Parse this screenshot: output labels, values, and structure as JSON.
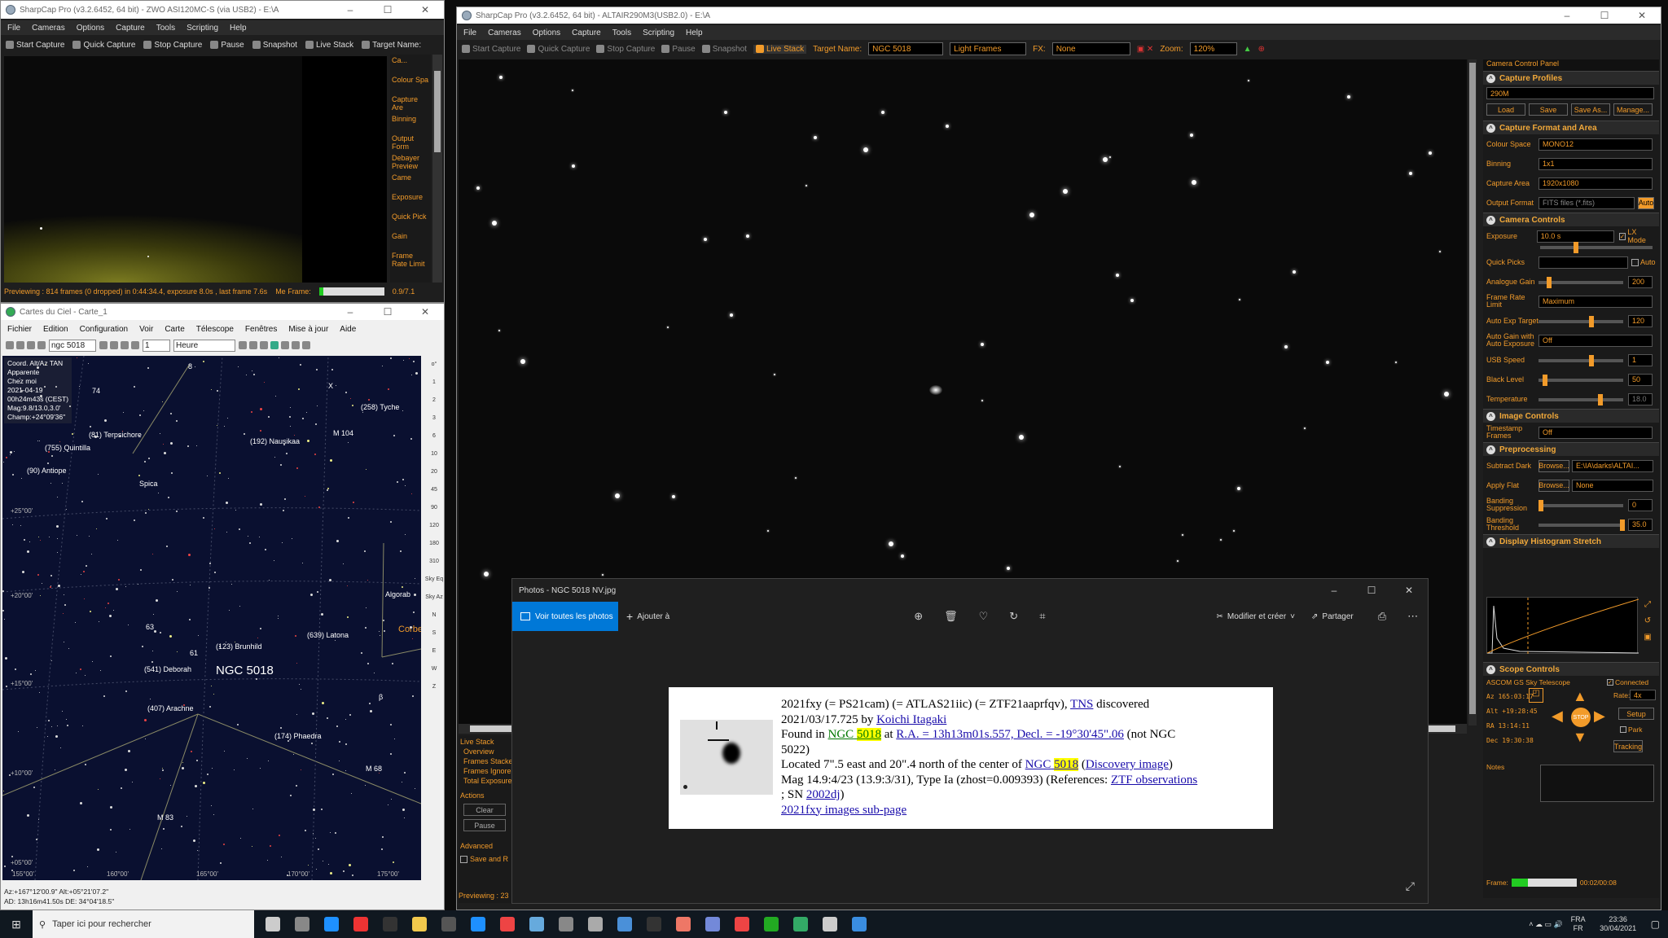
{
  "sharpcap_small": {
    "title": "SharpCap Pro (v3.2.6452, 64 bit) - ZWO ASI120MC-S (via USB2) - E:\\A",
    "menu": [
      "File",
      "Cameras",
      "Options",
      "Capture",
      "Tools",
      "Scripting",
      "Help"
    ],
    "toolbar": [
      "Start Capture",
      "Quick Capture",
      "Stop Capture",
      "Pause",
      "Snapshot",
      "Live Stack",
      "Target Name:"
    ],
    "side_labels": [
      "Ca...",
      "Colour Spa",
      "Capture Are",
      "Binning",
      "Output Form",
      "Debayer Preview",
      "Came",
      "Exposure",
      "Quick Pick",
      "Gain",
      "Frame Rate Limit"
    ],
    "status": "Previewing : 814 frames (0 dropped) in 0:44:34.4, exposure 8.0s , last frame 7.6s",
    "status_right": "Me Frame:",
    "frame_count": "0.9/7.1"
  },
  "carte": {
    "title": "Cartes du Ciel - Carte_1",
    "menu": [
      "Fichier",
      "Edition",
      "Configuration",
      "Voir",
      "Carte",
      "Télescope",
      "Fenêtres",
      "Mise à jour",
      "Aide"
    ],
    "search_value": "ngc 5018",
    "step_value": "1",
    "time_unit": "Heure",
    "info": [
      "Coord. Alt/Az TAN",
      "Apparente",
      "Chez moi",
      "2021-04-19",
      "00h24m43s (CEST)",
      "Mag:9.8/13.0,3.0'",
      "Champ:+24°09'36\""
    ],
    "labels": [
      {
        "t": "(755) Quintilla"
      },
      {
        "t": "(90) Antiope"
      },
      {
        "t": "(81) Terpsichore"
      },
      {
        "t": "(192) Nausikaa"
      },
      {
        "t": "M 104"
      },
      {
        "t": "(258) Tyche"
      },
      {
        "t": "Spica"
      },
      {
        "t": "Algorab"
      },
      {
        "t": "Corbe"
      },
      {
        "t": "(123) Brunhild"
      },
      {
        "t": "(639) Latona"
      },
      {
        "t": "(541) Deborah"
      },
      {
        "t": "NGC 5018"
      },
      {
        "t": "(407) Arachne"
      },
      {
        "t": "(174) Phaedra"
      },
      {
        "t": "M 68"
      },
      {
        "t": "M 83"
      },
      {
        "t": "74"
      },
      {
        "t": "8"
      },
      {
        "t": "X"
      },
      {
        "t": "61"
      },
      {
        "t": "63"
      },
      {
        "t": "β"
      }
    ],
    "dec_labels": [
      "+25°00'",
      "+20°00'",
      "+15°00'",
      "+10°00'",
      "+05°00'"
    ],
    "ra_labels": [
      "160°00'",
      "165°00'",
      "170°00'",
      "175°00'",
      "155°00'"
    ],
    "side_tools": [
      "o°",
      "1",
      "2",
      "3",
      "6",
      "10",
      "20",
      "45",
      "90",
      "120",
      "180",
      "310",
      "Sky Eq",
      "Sky Az",
      "N",
      "S",
      "E",
      "W",
      "Z"
    ],
    "status1": "Az:+167°12'00.9\" Alt:+05°21'07.2\"",
    "status2": "AD: 13h16m41.50s DE: 34°04'18.5\""
  },
  "sharpcap_main": {
    "title": "SharpCap Pro (v3.2.6452, 64 bit) - ALTAIR290M3(USB2.0) - E:\\A",
    "menu": [
      "File",
      "Cameras",
      "Options",
      "Capture",
      "Tools",
      "Scripting",
      "Help"
    ],
    "toolbar": {
      "start": "Start Capture",
      "quick": "Quick Capture",
      "stop": "Stop Capture",
      "pause": "Pause",
      "snapshot": "Snapshot",
      "live": "Live Stack",
      "target_label": "Target Name:",
      "target_value": "NGC 5018",
      "frame_type": "Light Frames",
      "fx_label": "FX:",
      "fx_value": "None",
      "zoom_label": "Zoom:",
      "zoom_value": "120%"
    },
    "live_stack": {
      "title": "Live Stack",
      "items": [
        "Overview",
        "Frames Stacke",
        "Frames Ignore",
        "Total Exposure"
      ],
      "actions_title": "Actions",
      "clear": "Clear",
      "pause": "Pause",
      "advanced": "Advanced",
      "save_and": "Save and R"
    },
    "status": "Previewing : 23",
    "frame_label": "Frame:",
    "frame_time": "00:02/00:08"
  },
  "camera_panel": {
    "title": "Camera Control Panel",
    "capture_profiles": {
      "h": "Capture Profiles",
      "value": "290M",
      "buttons": [
        "Load",
        "Save",
        "Save As...",
        "Manage..."
      ]
    },
    "format": {
      "h": "Capture Format and Area",
      "rows": [
        [
          "Colour Space",
          "MONO12"
        ],
        [
          "Binning",
          "1x1"
        ],
        [
          "Capture Area",
          "1920x1080"
        ],
        [
          "Output Format",
          "FITS files (*.fits)"
        ]
      ],
      "auto": "Auto"
    },
    "controls": {
      "h": "Camera Controls",
      "exposure_label": "Exposure",
      "exposure_value": "10.0 s",
      "lx": "LX Mode",
      "quick_picks": "Quick Picks",
      "auto": "Auto",
      "rows": [
        [
          "Analogue Gain",
          "200"
        ],
        [
          "Frame Rate Limit",
          "Maximum"
        ],
        [
          "Auto Exp Target",
          "120"
        ],
        [
          "Auto Gain with Auto Exposure",
          "Off"
        ],
        [
          "USB Speed",
          "1"
        ],
        [
          "Black Level",
          "50"
        ],
        [
          "Temperature",
          "18.0"
        ]
      ]
    },
    "image": {
      "h": "Image Controls",
      "rows": [
        [
          "Timestamp Frames",
          "Off"
        ]
      ]
    },
    "preproc": {
      "h": "Preprocessing",
      "rows": [
        [
          "Subtract Dark",
          "Browse...",
          "E:\\IA\\darks\\ALTAI..."
        ],
        [
          "Apply Flat",
          "Browse...",
          "None"
        ],
        [
          "Banding Suppression",
          "0"
        ],
        [
          "Banding Threshold",
          "35.0"
        ]
      ]
    },
    "histogram": {
      "h": "Display Histogram Stretch"
    },
    "scope": {
      "h": "Scope Controls",
      "name": "ASCOM GS Sky Telescope",
      "connected": "Connected",
      "rate_label": "Rate:",
      "rate_value": "4x",
      "coords": [
        "Az  165:03:17",
        "Alt +19:28:45",
        "RA  13:14:11",
        "Dec 19:30:38"
      ],
      "setup": "Setup",
      "park": "Park",
      "tracking": "Tracking",
      "stop": "STOP"
    },
    "notes": "Notes"
  },
  "photos": {
    "title": "Photos - NGC 5018 NV.jpg",
    "voir": "Voir toutes les photos",
    "ajouter": "Ajouter à",
    "modifier": "Modifier et créer",
    "partager": "Partager",
    "text": {
      "l1a": "2021fxy (= PS21cam) (= ATLAS21iic) (= ZTF21aaprfqv), ",
      "tns": "TNS",
      "l1b": " discovered",
      "l2a": "2021/03/17.725 by ",
      "koichi": "Koichi Itagaki",
      "l3a": "Found in ",
      "ngc1": "NGC",
      "n1": "5018",
      "l3b": " at ",
      "radec": "R.A. = 13h13m01s.557, Decl. = -19°30'45\".06",
      "l3c": " (not NGC",
      "l4": "5022)",
      "l5a": "Located 7\".5 east and 20\".4 north of the center of ",
      "ngc2": "NGC",
      "n2": "5018",
      "l5b": " (",
      "disc": "Discovery image",
      "l5c": ")",
      "l6a": "Mag 14.9:4/23 (13.9:3/31), Type Ia (zhost=0.009393) (References: ",
      "ztf": "ZTF observations",
      "l7a": "; SN ",
      "sn": "2002dj",
      "l7b": ")",
      "sub": "2021fxy images sub-page"
    }
  },
  "taskbar": {
    "search": "Taper ici pour rechercher",
    "lang1": "FRA",
    "lang2": "FR",
    "time": "23:36",
    "date": "30/04/2021"
  },
  "colors": {
    "accent": "#f29b2a",
    "sky": "#0a1030",
    "hl": "#ffff00",
    "photos_blue": "#0078d7"
  }
}
